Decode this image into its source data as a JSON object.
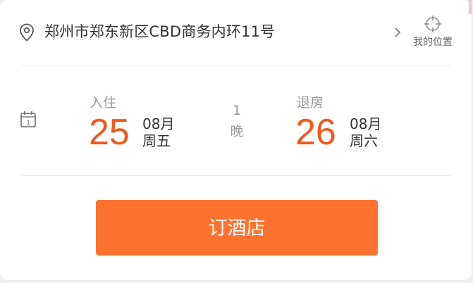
{
  "address": {
    "text": "郑州市郑东新区CBD商务内环11号",
    "icon": "location-pin-icon",
    "chevron_icon": "chevron-right-icon"
  },
  "my_location": {
    "label": "我的位置",
    "icon": "crosshair-icon"
  },
  "calendar": {
    "icon": "calendar-icon",
    "icon_text": "1"
  },
  "check_in": {
    "label": "入住",
    "day": "25",
    "month": "08月",
    "weekday": "周五"
  },
  "nights": {
    "count": "1",
    "unit": "晚"
  },
  "check_out": {
    "label": "退房",
    "day": "26",
    "month": "08月",
    "weekday": "周六"
  },
  "book_button": {
    "label": "订酒店"
  },
  "colors": {
    "accent_orange": "#fe7230",
    "date_orange": "#ee5a1c",
    "muted_text": "#999999",
    "primary_text": "#333333"
  }
}
